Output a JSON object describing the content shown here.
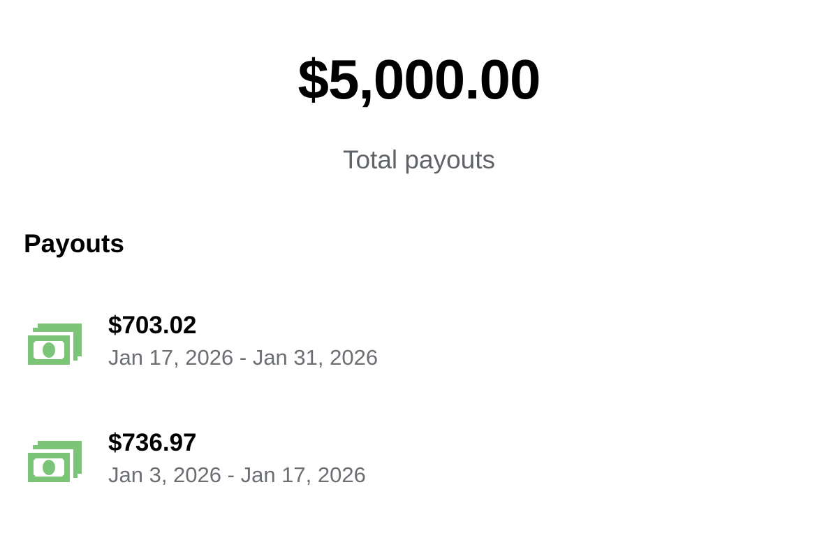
{
  "summary": {
    "total_amount": "$5,000.00",
    "total_label": "Total payouts"
  },
  "payouts": {
    "title": "Payouts",
    "icon": "money-icon",
    "accent_color": "#7cc477",
    "items": [
      {
        "amount": "$703.02",
        "period": "Jan 17, 2026 - Jan 31, 2026"
      },
      {
        "amount": "$736.97",
        "period": "Jan 3, 2026 - Jan 17, 2026"
      }
    ]
  }
}
